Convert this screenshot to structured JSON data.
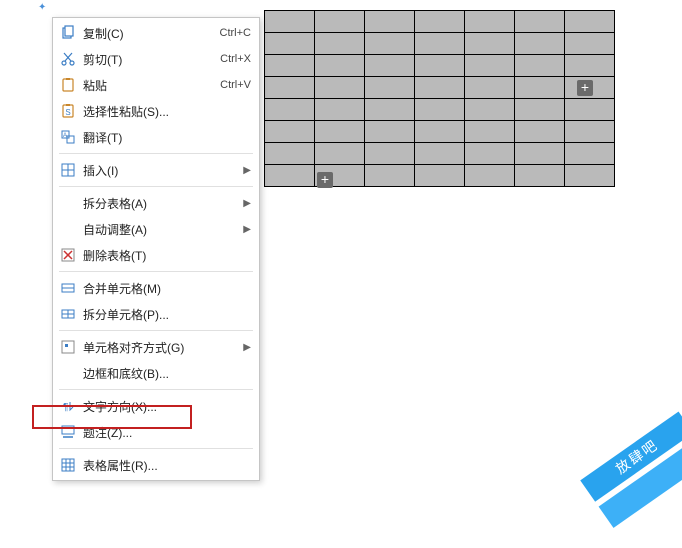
{
  "corner_mark": "✦",
  "context_menu": {
    "items": [
      {
        "id": "copy",
        "label": "复制(C)",
        "shortcut": "Ctrl+C",
        "icon": "copy-icon"
      },
      {
        "id": "cut",
        "label": "剪切(T)",
        "shortcut": "Ctrl+X",
        "icon": "cut-icon"
      },
      {
        "id": "paste",
        "label": "粘贴",
        "shortcut": "Ctrl+V",
        "icon": "paste-icon"
      },
      {
        "id": "paste-special",
        "label": "选择性粘贴(S)...",
        "icon": "paste-special-icon"
      },
      {
        "id": "translate",
        "label": "翻译(T)",
        "icon": "translate-icon"
      },
      {
        "id": "insert",
        "label": "插入(I)",
        "icon": "insert-icon",
        "submenu": true
      },
      {
        "id": "split-table",
        "label": "拆分表格(A)",
        "submenu": true
      },
      {
        "id": "autofit",
        "label": "自动调整(A)",
        "submenu": true
      },
      {
        "id": "delete-table",
        "label": "删除表格(T)",
        "icon": "delete-table-icon"
      },
      {
        "id": "merge-cells",
        "label": "合并单元格(M)",
        "icon": "merge-cells-icon"
      },
      {
        "id": "split-cells",
        "label": "拆分单元格(P)...",
        "icon": "split-cells-icon"
      },
      {
        "id": "cell-align",
        "label": "单元格对齐方式(G)",
        "icon": "cell-align-icon",
        "submenu": true
      },
      {
        "id": "borders-shading",
        "label": "边框和底纹(B)..."
      },
      {
        "id": "text-direction",
        "label": "文字方向(X)...",
        "icon": "text-direction-icon"
      },
      {
        "id": "caption",
        "label": "题注(Z)...",
        "icon": "caption-icon"
      },
      {
        "id": "table-properties",
        "label": "表格属性(R)...",
        "icon": "table-properties-icon",
        "highlighted": true
      }
    ],
    "separators_after": [
      "translate",
      "insert",
      "delete-table",
      "split-cells",
      "borders-shading",
      "caption"
    ]
  },
  "table": {
    "rows": 8,
    "cols": 7
  },
  "add_handles": {
    "row": "+",
    "col": "+"
  },
  "watermark": "放肆吧"
}
